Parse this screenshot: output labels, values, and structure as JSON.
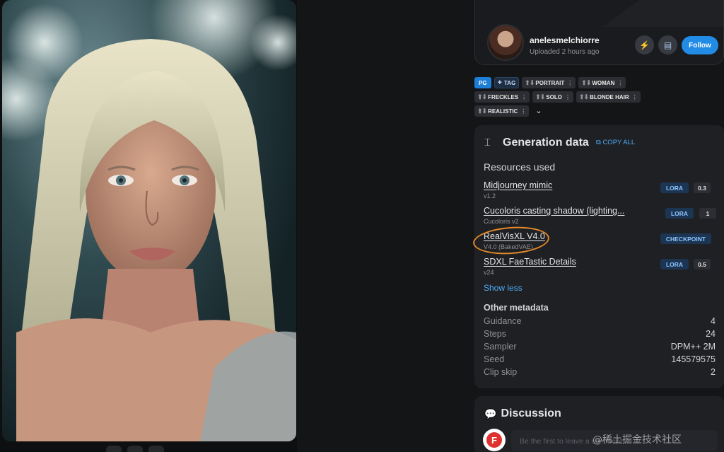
{
  "profile": {
    "username": "anelesmelchiorre",
    "uploaded": "Uploaded 2 hours ago",
    "follow_label": "Follow",
    "bolt_icon": "lightning-icon",
    "chat_icon": "message-icon"
  },
  "tags": {
    "rating": "PG",
    "add_label": "TAG",
    "items": [
      "PORTRAIT",
      "WOMAN",
      "FRECKLES",
      "SOLO",
      "BLONDE HAIR",
      "REALISTIC"
    ]
  },
  "generation": {
    "title": "Generation data",
    "copy_all": "COPY ALL",
    "resources_title": "Resources used",
    "resources": [
      {
        "name": "Midjourney mimic",
        "version": "v1.2",
        "type": "LORA",
        "weight": "0.3"
      },
      {
        "name": "Cucoloris casting shadow (lighting...",
        "version": "Cucoloris v2",
        "type": "LORA",
        "weight": "1"
      },
      {
        "name": "RealVisXL V4.0",
        "version": "V4.0 (BakedVAE)",
        "type": "CHECKPOINT",
        "weight": ""
      },
      {
        "name": "SDXL FaeTastic Details",
        "version": "v24",
        "type": "LORA",
        "weight": "0.5"
      }
    ],
    "show_less": "Show less",
    "other_title": "Other metadata",
    "metadata": [
      {
        "label": "Guidance",
        "value": "4"
      },
      {
        "label": "Steps",
        "value": "24"
      },
      {
        "label": "Sampler",
        "value": "DPM++ 2M"
      },
      {
        "label": "Seed",
        "value": "145579575"
      },
      {
        "label": "Clip skip",
        "value": "2"
      }
    ]
  },
  "discussion": {
    "title": "Discussion",
    "avatar_letter": "F",
    "placeholder": "Be the first to leave a comment..."
  },
  "watermark": "@稀土掘金技术社区",
  "colors": {
    "accent": "#228be6",
    "link": "#4dabf7",
    "highlight_ring": "#e0892a",
    "panel_bg": "#1f2023"
  }
}
